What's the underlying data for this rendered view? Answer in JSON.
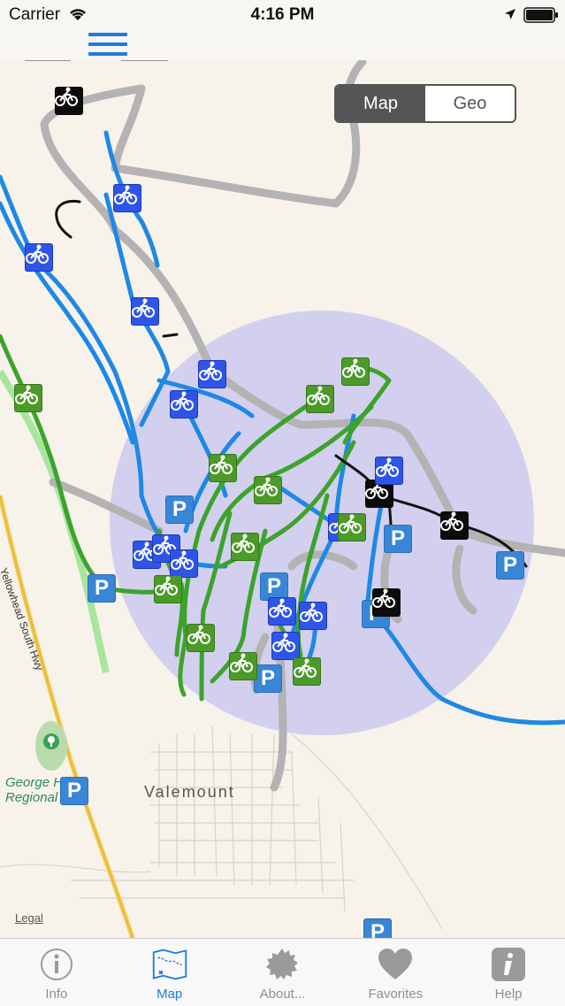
{
  "status": {
    "carrier": "Carrier",
    "time": "4:16 PM"
  },
  "segment": {
    "map_label": "Map",
    "geo_label": "Geo",
    "selected": "Map"
  },
  "map": {
    "town_label": "Valemount",
    "park_label_line1": "George Hicks",
    "park_label_line2": "Regional Park",
    "road_label": "Yellowhead South Hwy",
    "legal_label": "Legal",
    "parking_glyph": "P",
    "colors": {
      "blue_trail": "#1e88e5",
      "green_trail": "#3ca32c",
      "grey_road": "#b3b3b3",
      "black_trail": "#111111",
      "radius_fill": "#b9b9f0",
      "highway": "#f2c94c"
    }
  },
  "tabs": [
    {
      "label": "Info",
      "icon": "info-icon"
    },
    {
      "label": "Map",
      "icon": "map-icon",
      "active": true
    },
    {
      "label": "About...",
      "icon": "badge-icon"
    },
    {
      "label": "Favorites",
      "icon": "heart-icon"
    },
    {
      "label": "Help",
      "icon": "help-icon"
    }
  ]
}
